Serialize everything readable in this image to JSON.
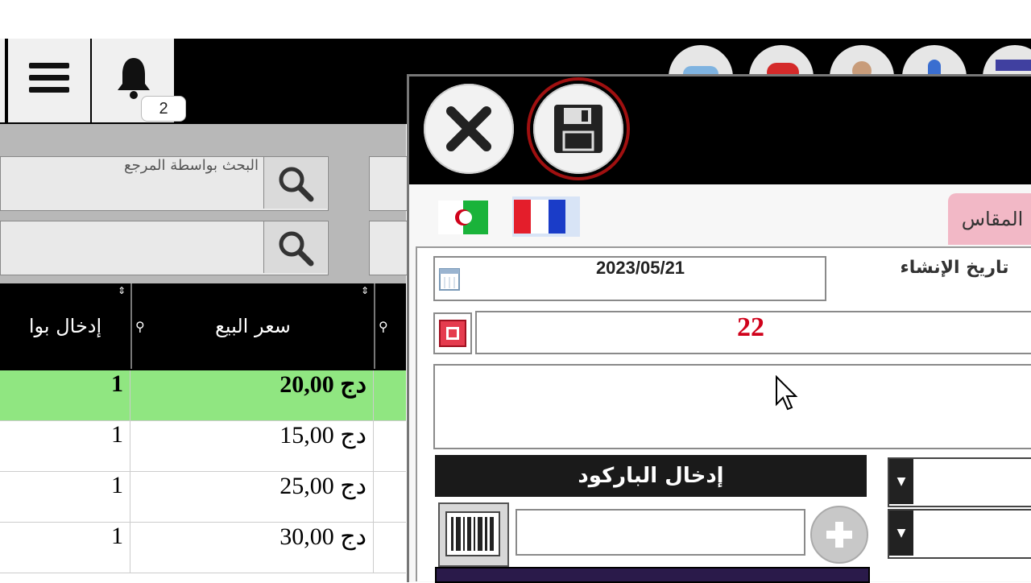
{
  "toolbar": {
    "notification_count": "2"
  },
  "left_panel": {
    "search_reference_placeholder": "البحث بواسطة المرجع",
    "columns": [
      "إدخال بوا",
      "سعر البيع"
    ],
    "rows": [
      {
        "qty": "1",
        "price": "20,00 دج",
        "selected": true
      },
      {
        "qty": "1",
        "price": "15,00 دج",
        "selected": false
      },
      {
        "qty": "1",
        "price": "25,00 دج",
        "selected": false
      },
      {
        "qty": "1",
        "price": "30,00 دج",
        "selected": false
      }
    ]
  },
  "dialog": {
    "tab_label": "المقاس",
    "creation_date_label": "تاريخ الإنشاء",
    "creation_date_value": "2023/05/21",
    "number_value": "22",
    "barcode_label": "إدخال الباركود",
    "barcode_input_value": ""
  },
  "colors": {
    "selected_row": "#90e681",
    "number_red": "#d0021b",
    "tab_pink": "#f2b8c6",
    "header_black": "#000000"
  },
  "icons": [
    "menu-icon",
    "bell-icon",
    "search-icon",
    "close-icon",
    "save-icon",
    "calendar-icon",
    "stop-icon",
    "barcode-icon",
    "plus-icon",
    "chevron-down-icon",
    "flag-algeria-icon",
    "flag-france-icon"
  ]
}
